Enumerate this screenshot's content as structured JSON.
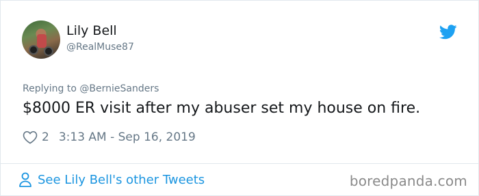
{
  "author": {
    "name": "Lily Bell",
    "handle": "@RealMuse87"
  },
  "tweet": {
    "reply_prefix": "Replying to ",
    "reply_mention": "@BernieSanders",
    "text": "$8000 ER visit after my abuser set my house on fire.",
    "likes": "2",
    "timestamp": "3:13 AM - Sep 16, 2019"
  },
  "footer": {
    "see_more_label": "See Lily Bell's other Tweets",
    "watermark": "boredpanda.com"
  },
  "icons": {
    "brand": "twitter-bird-icon",
    "like": "heart-icon",
    "profile": "person-icon"
  },
  "colors": {
    "twitter_blue": "#1da1f2",
    "link_blue": "#1b95e0",
    "muted": "#657786",
    "text": "#14171a"
  }
}
